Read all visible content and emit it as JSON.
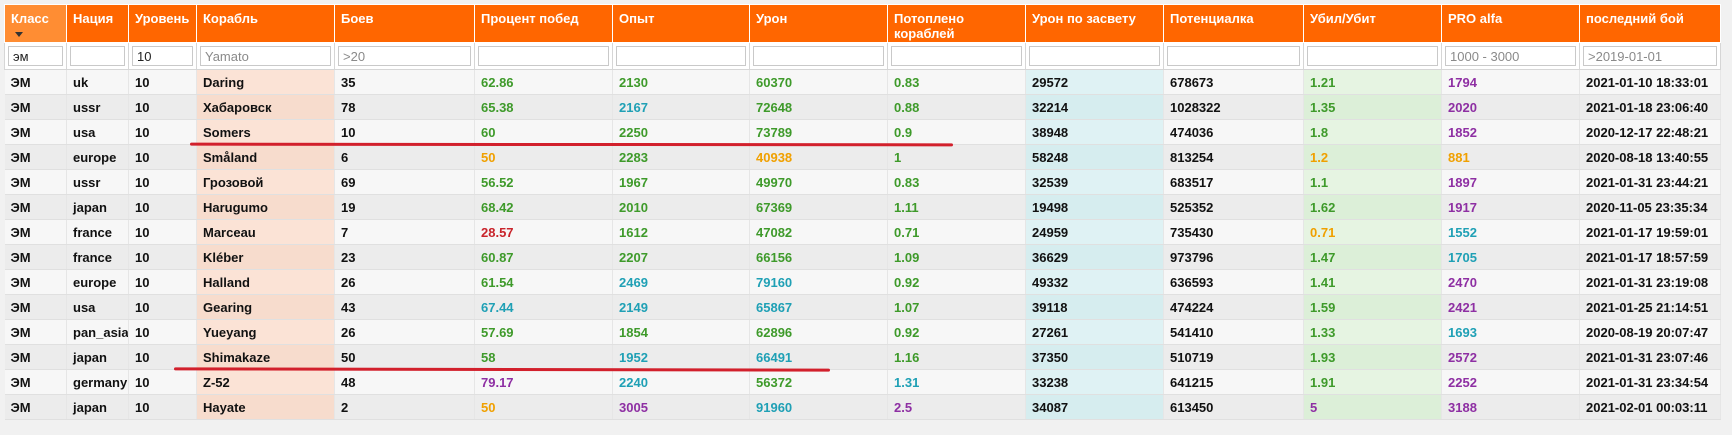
{
  "columns": [
    "Класс",
    "Нация",
    "Уровень",
    "Корабль",
    "Боев",
    "Процент побед",
    "Опыт",
    "Урон",
    "Потоплено кораблей",
    "Урон по засвету",
    "Потенциалка",
    "Убил/Убит",
    "PRO alfa",
    "последний бой"
  ],
  "filters": {
    "class_value": "эм",
    "level_value": "10",
    "ship_placeholder": "Yamato",
    "battles_placeholder": ">20",
    "pro_placeholder": "1000 - 3000",
    "last_battle_placeholder": ">2019-01-01"
  },
  "colors": {
    "green": "#3e9a2a",
    "teal": "#1fa0b5",
    "purple": "#8e2fa3",
    "orange": "#f0a000",
    "red": "#c9242b",
    "header": "#ff6600"
  },
  "rows": [
    {
      "cls": "ЭМ",
      "nation": "uk",
      "tier": "10",
      "ship": "Daring",
      "battles": "35",
      "wr": "62.86",
      "wr_c": "green",
      "xp": "2130",
      "xp_c": "green",
      "dmg": "60370",
      "dmg_c": "green",
      "kills": "0.83",
      "kills_c": "green",
      "spot": "29572",
      "pot": "678673",
      "kd": "1.21",
      "kd_c": "green",
      "pro": "1794",
      "pro_c": "purple",
      "last": "2021-01-10 18:33:01"
    },
    {
      "cls": "ЭМ",
      "nation": "ussr",
      "tier": "10",
      "ship": "Хабаровск",
      "battles": "78",
      "wr": "65.38",
      "wr_c": "green",
      "xp": "2167",
      "xp_c": "teal",
      "dmg": "72648",
      "dmg_c": "green",
      "kills": "0.88",
      "kills_c": "green",
      "spot": "32214",
      "pot": "1028322",
      "kd": "1.35",
      "kd_c": "green",
      "pro": "2020",
      "pro_c": "purple",
      "last": "2021-01-18 23:06:40"
    },
    {
      "cls": "ЭМ",
      "nation": "usa",
      "tier": "10",
      "ship": "Somers",
      "battles": "10",
      "wr": "60",
      "wr_c": "green",
      "xp": "2250",
      "xp_c": "green",
      "dmg": "73789",
      "dmg_c": "green",
      "kills": "0.9",
      "kills_c": "green",
      "spot": "38948",
      "pot": "474036",
      "kd": "1.8",
      "kd_c": "green",
      "pro": "1852",
      "pro_c": "purple",
      "last": "2020-12-17 22:48:21"
    },
    {
      "cls": "ЭМ",
      "nation": "europe",
      "tier": "10",
      "ship": "Småland",
      "battles": "6",
      "wr": "50",
      "wr_c": "orange",
      "xp": "2283",
      "xp_c": "green",
      "dmg": "40938",
      "dmg_c": "orange",
      "kills": "1",
      "kills_c": "green",
      "spot": "58248",
      "pot": "813254",
      "kd": "1.2",
      "kd_c": "orange",
      "pro": "881",
      "pro_c": "orange",
      "last": "2020-08-18 13:40:55"
    },
    {
      "cls": "ЭМ",
      "nation": "ussr",
      "tier": "10",
      "ship": "Грозовой",
      "battles": "69",
      "wr": "56.52",
      "wr_c": "green",
      "xp": "1967",
      "xp_c": "green",
      "dmg": "49970",
      "dmg_c": "green",
      "kills": "0.83",
      "kills_c": "green",
      "spot": "32539",
      "pot": "683517",
      "kd": "1.1",
      "kd_c": "green",
      "pro": "1897",
      "pro_c": "purple",
      "last": "2021-01-31 23:44:21"
    },
    {
      "cls": "ЭМ",
      "nation": "japan",
      "tier": "10",
      "ship": "Harugumo",
      "battles": "19",
      "wr": "68.42",
      "wr_c": "green",
      "xp": "2010",
      "xp_c": "green",
      "dmg": "67369",
      "dmg_c": "green",
      "kills": "1.11",
      "kills_c": "green",
      "spot": "19498",
      "pot": "525352",
      "kd": "1.62",
      "kd_c": "green",
      "pro": "1917",
      "pro_c": "purple",
      "last": "2020-11-05 23:35:34"
    },
    {
      "cls": "ЭМ",
      "nation": "france",
      "tier": "10",
      "ship": "Marceau",
      "battles": "7",
      "wr": "28.57",
      "wr_c": "red",
      "xp": "1612",
      "xp_c": "green",
      "dmg": "47082",
      "dmg_c": "green",
      "kills": "0.71",
      "kills_c": "green",
      "spot": "24959",
      "pot": "735430",
      "kd": "0.71",
      "kd_c": "orange",
      "pro": "1552",
      "pro_c": "teal",
      "last": "2021-01-17 19:59:01"
    },
    {
      "cls": "ЭМ",
      "nation": "france",
      "tier": "10",
      "ship": "Kléber",
      "battles": "23",
      "wr": "60.87",
      "wr_c": "green",
      "xp": "2207",
      "xp_c": "green",
      "dmg": "66156",
      "dmg_c": "green",
      "kills": "1.09",
      "kills_c": "green",
      "spot": "36629",
      "pot": "973796",
      "kd": "1.47",
      "kd_c": "green",
      "pro": "1705",
      "pro_c": "teal",
      "last": "2021-01-17 18:57:59"
    },
    {
      "cls": "ЭМ",
      "nation": "europe",
      "tier": "10",
      "ship": "Halland",
      "battles": "26",
      "wr": "61.54",
      "wr_c": "green",
      "xp": "2469",
      "xp_c": "teal",
      "dmg": "79160",
      "dmg_c": "teal",
      "kills": "0.92",
      "kills_c": "green",
      "spot": "49332",
      "pot": "636593",
      "kd": "1.41",
      "kd_c": "green",
      "pro": "2470",
      "pro_c": "purple",
      "last": "2021-01-31 23:19:08"
    },
    {
      "cls": "ЭМ",
      "nation": "usa",
      "tier": "10",
      "ship": "Gearing",
      "battles": "43",
      "wr": "67.44",
      "wr_c": "teal",
      "xp": "2149",
      "xp_c": "teal",
      "dmg": "65867",
      "dmg_c": "teal",
      "kills": "1.07",
      "kills_c": "green",
      "spot": "39118",
      "pot": "474224",
      "kd": "1.59",
      "kd_c": "green",
      "pro": "2421",
      "pro_c": "purple",
      "last": "2021-01-25 21:14:51"
    },
    {
      "cls": "ЭМ",
      "nation": "pan_asia",
      "tier": "10",
      "ship": "Yueyang",
      "battles": "26",
      "wr": "57.69",
      "wr_c": "green",
      "xp": "1854",
      "xp_c": "green",
      "dmg": "62896",
      "dmg_c": "green",
      "kills": "0.92",
      "kills_c": "green",
      "spot": "27261",
      "pot": "541410",
      "kd": "1.33",
      "kd_c": "green",
      "pro": "1693",
      "pro_c": "teal",
      "last": "2020-08-19 20:07:47"
    },
    {
      "cls": "ЭМ",
      "nation": "japan",
      "tier": "10",
      "ship": "Shimakaze",
      "battles": "50",
      "wr": "58",
      "wr_c": "green",
      "xp": "1952",
      "xp_c": "teal",
      "dmg": "66491",
      "dmg_c": "teal",
      "kills": "1.16",
      "kills_c": "green",
      "spot": "37350",
      "pot": "510719",
      "kd": "1.93",
      "kd_c": "green",
      "pro": "2572",
      "pro_c": "purple",
      "last": "2021-01-31 23:07:46"
    },
    {
      "cls": "ЭМ",
      "nation": "germany",
      "tier": "10",
      "ship": "Z-52",
      "battles": "48",
      "wr": "79.17",
      "wr_c": "purple",
      "xp": "2240",
      "xp_c": "teal",
      "dmg": "56372",
      "dmg_c": "green",
      "kills": "1.31",
      "kills_c": "teal",
      "spot": "33238",
      "pot": "641215",
      "kd": "1.91",
      "kd_c": "green",
      "pro": "2252",
      "pro_c": "purple",
      "last": "2021-01-31 23:34:54"
    },
    {
      "cls": "ЭМ",
      "nation": "japan",
      "tier": "10",
      "ship": "Hayate",
      "battles": "2",
      "wr": "50",
      "wr_c": "orange",
      "xp": "3005",
      "xp_c": "purple",
      "dmg": "91960",
      "dmg_c": "teal",
      "kills": "2.5",
      "kills_c": "purple",
      "spot": "34087",
      "pot": "613450",
      "kd": "5",
      "kd_c": "purple",
      "pro": "3188",
      "pro_c": "purple",
      "last": "2021-02-01 00:03:11"
    }
  ]
}
